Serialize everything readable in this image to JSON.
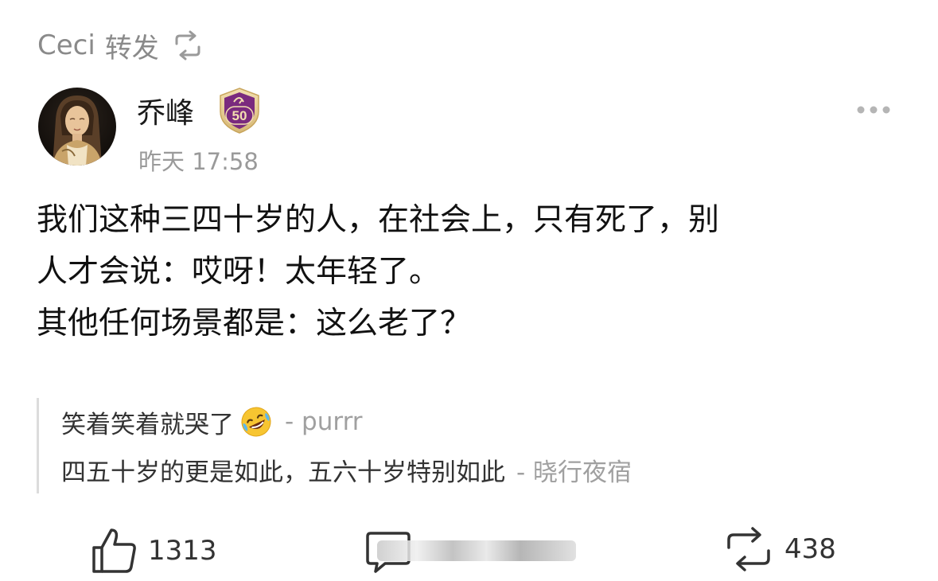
{
  "repost": {
    "reposter": "Ceci",
    "action": "转发"
  },
  "post": {
    "author": "乔峰",
    "level": "50",
    "time": "昨天 17:58",
    "lines": [
      "我们这种三四十岁的人，在社会上，只有死了，别",
      "人才会说：哎呀！太年轻了。",
      "其他任何场景都是：这么老了？"
    ]
  },
  "comments": [
    {
      "text": "笑着笑着就哭了",
      "emoji": "rolling-on-floor-laughing",
      "author": "- purrr"
    },
    {
      "text": "四五十岁的更是如此，五六十岁特别如此",
      "author": "- 晓行夜宿"
    }
  ],
  "actions": {
    "likes": "1313",
    "reposts": "438"
  },
  "colors": {
    "text": "#1a1a1a",
    "muted": "#9a9a9a",
    "badge": "#7a2a7e",
    "badge_light": "#e6cf9a"
  }
}
